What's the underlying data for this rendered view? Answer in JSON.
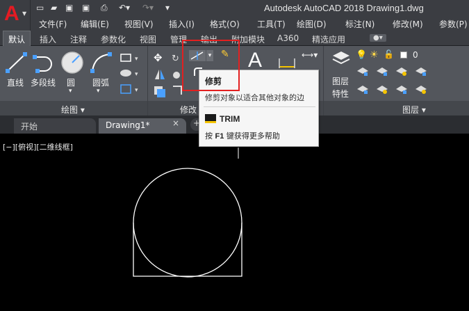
{
  "app": {
    "logo_letter": "A",
    "title": "Autodesk AutoCAD 2018    Drawing1.dwg"
  },
  "menu": [
    "文件(F)",
    "编辑(E)",
    "视图(V)",
    "插入(I)",
    "格式(O)",
    "工具(T)",
    "绘图(D)",
    "标注(N)",
    "修改(M)",
    "参数(P)"
  ],
  "ribbon_tabs": [
    "默认",
    "插入",
    "注释",
    "参数化",
    "视图",
    "管理",
    "输出",
    "附加模块",
    "A360",
    "精选应用"
  ],
  "draw_panel": {
    "buttons": [
      "直线",
      "多段线",
      "圆",
      "圆弧"
    ],
    "group_label": "绘图 ▾"
  },
  "modify_panel": {
    "group_label": "修改"
  },
  "layers_panel": {
    "layer_name": "0",
    "properties_label_1": "图层",
    "properties_label_2": "特性",
    "group_label": "图层 ▾"
  },
  "doc_tabs": [
    "开始",
    "Drawing1*"
  ],
  "viewport_label": "[−][俯视][二维线框]",
  "tooltip": {
    "title": "修剪",
    "description": "修剪对象以适合其他对象的边",
    "command": "TRIM",
    "help_prefix": "按 ",
    "help_key": "F1",
    "help_suffix": " 键获得更多帮助"
  },
  "colors": {
    "highlight": "#e32020",
    "logo": "#e41b23",
    "ribbon": "#53565c",
    "canvas": "#000000"
  }
}
